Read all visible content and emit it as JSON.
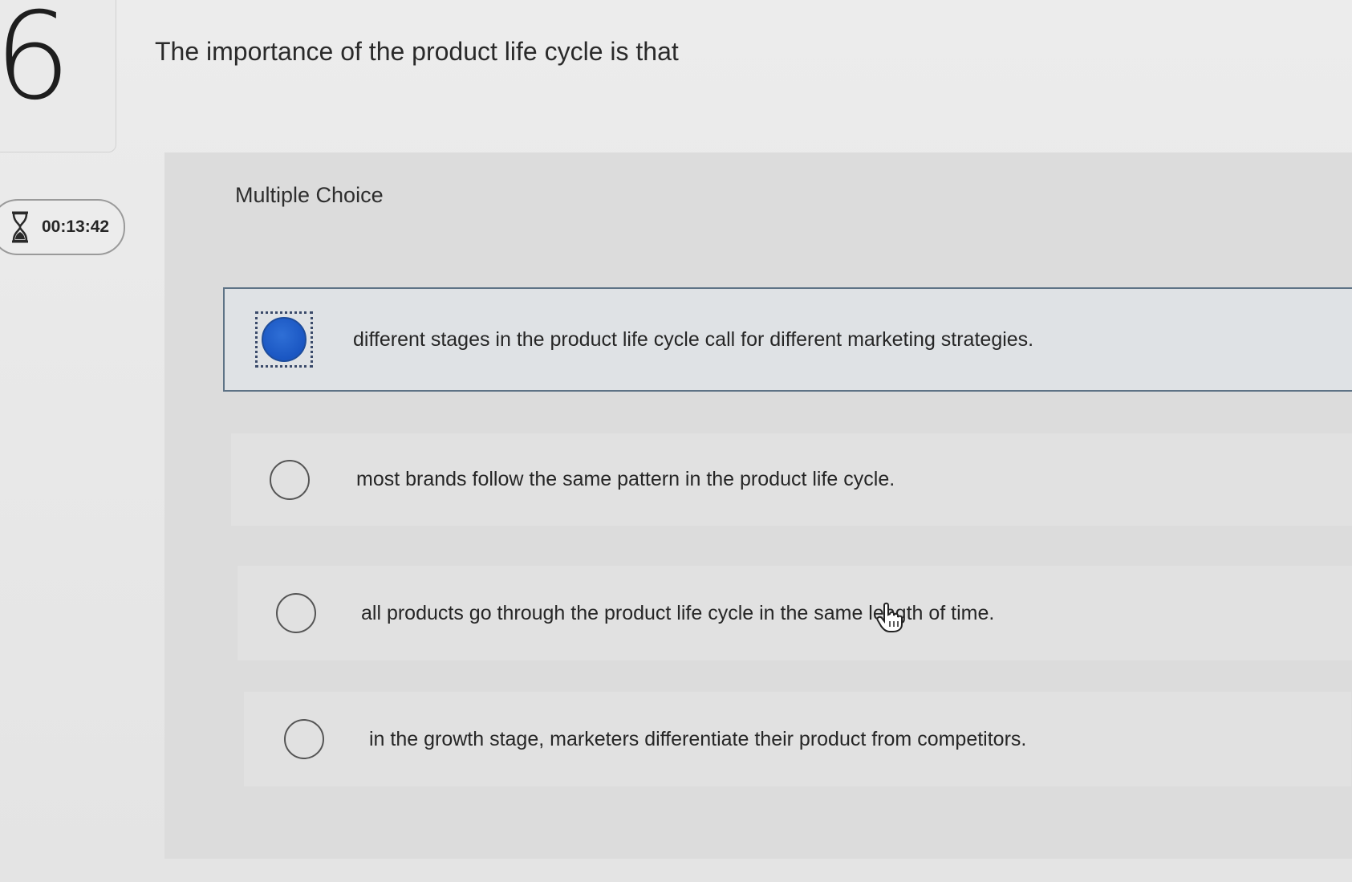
{
  "question": {
    "number": "6",
    "text": "The importance of the product life cycle is that",
    "type_label": "Multiple Choice"
  },
  "timer": {
    "icon": "hourglass-icon",
    "value": "00:13:42"
  },
  "options": [
    {
      "text": "different stages in the product life cycle call for different marketing strategies.",
      "selected": true
    },
    {
      "text": "most brands follow the same pattern in the product life cycle.",
      "selected": false
    },
    {
      "text": "all products go through the product life cycle in the same length of time.",
      "selected": false
    },
    {
      "text": "in the growth stage, marketers differentiate their product from competitors.",
      "selected": false
    }
  ],
  "colors": {
    "selected_radio": "#1a56c2",
    "selected_border": "#5e7386"
  }
}
